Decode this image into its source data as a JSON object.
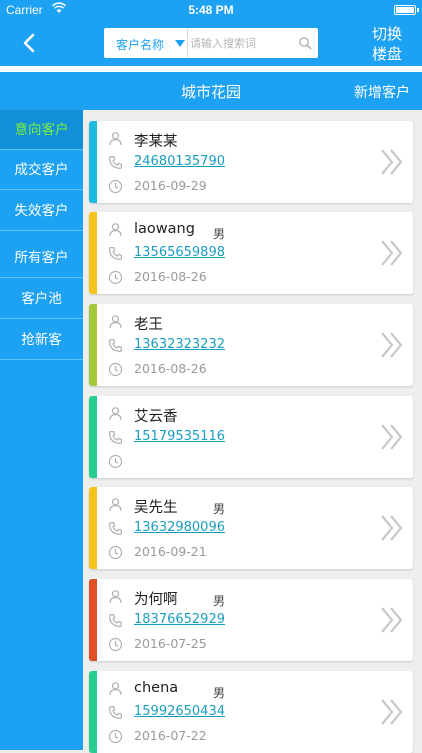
{
  "status_bar": {
    "carrier": "Carrier",
    "time": "5:48 PM"
  },
  "nav": {
    "search_category": "客户名称",
    "search_placeholder": "请输入搜索词",
    "switch_line1": "切换",
    "switch_line2": "楼盘"
  },
  "header": {
    "title": "城市花园",
    "new_customer": "新增客户"
  },
  "sidebar": {
    "items": [
      {
        "label": "意向客户",
        "active": true
      },
      {
        "label": "成交客户",
        "active": false
      },
      {
        "label": "失效客户",
        "active": false
      },
      {
        "label": "所有客户",
        "active": false
      },
      {
        "label": "客户池",
        "active": false
      },
      {
        "label": "抢新客",
        "active": false
      }
    ]
  },
  "customers": [
    {
      "name": "李某某",
      "gender": "",
      "phone": "24680135790",
      "date": "2016-09-29",
      "color": "#1fb9e0"
    },
    {
      "name": "laowang",
      "gender": "男",
      "phone": "13565659898",
      "date": "2016-08-26",
      "color": "#f6c21c"
    },
    {
      "name": "老王",
      "gender": "",
      "phone": "13632323232",
      "date": "2016-08-26",
      "color": "#a3c83a"
    },
    {
      "name": "艾云香",
      "gender": "",
      "phone": "15179535116",
      "date": "",
      "color": "#27cc8f"
    },
    {
      "name": "吴先生",
      "gender": "男",
      "phone": "13632980096",
      "date": "2016-09-21",
      "color": "#f6c21c"
    },
    {
      "name": "为何啊",
      "gender": "男",
      "phone": "18376652929",
      "date": "2016-07-25",
      "color": "#df5028"
    },
    {
      "name": "chena",
      "gender": "男",
      "phone": "15992650434",
      "date": "2016-07-22",
      "color": "#27cc8f"
    }
  ],
  "icons": {
    "back": "chevron-left-icon",
    "search": "search-icon",
    "person": "person-icon",
    "phone": "phone-icon",
    "clock": "clock-icon",
    "detail": "double-chevron-right-icon"
  },
  "colors": {
    "primary": "#1da1f2",
    "sidebar_active_bg": "#118fd8",
    "sidebar_active_text": "#7ff03d",
    "phone_link": "#1a9ec0"
  }
}
